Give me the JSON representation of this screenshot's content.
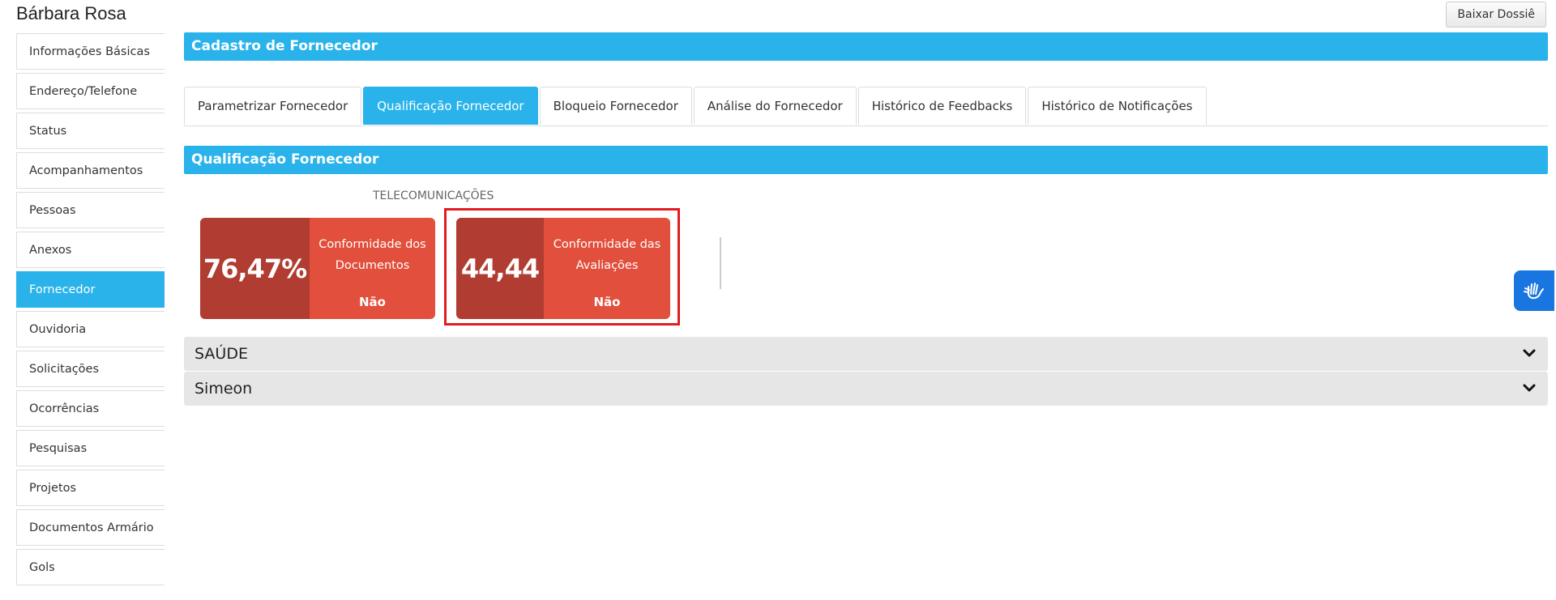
{
  "header": {
    "person_name": "Bárbara Rosa",
    "download_label": "Baixar Dossiê"
  },
  "sidebar": {
    "items": [
      {
        "label": "Informações Básicas",
        "active": false
      },
      {
        "label": "Endereço/Telefone",
        "active": false
      },
      {
        "label": "Status",
        "active": false
      },
      {
        "label": "Acompanhamentos",
        "active": false
      },
      {
        "label": "Pessoas",
        "active": false
      },
      {
        "label": "Anexos",
        "active": false
      },
      {
        "label": "Fornecedor",
        "active": true
      },
      {
        "label": "Ouvidoria",
        "active": false
      },
      {
        "label": "Solicitações",
        "active": false
      },
      {
        "label": "Ocorrências",
        "active": false
      },
      {
        "label": "Pesquisas",
        "active": false
      },
      {
        "label": "Projetos",
        "active": false
      },
      {
        "label": "Documentos Armário",
        "active": false
      },
      {
        "label": "Gols",
        "active": false
      }
    ]
  },
  "main": {
    "section_title": "Cadastro de Fornecedor",
    "tabs": [
      {
        "label": "Parametrizar Fornecedor",
        "active": false
      },
      {
        "label": "Qualificação Fornecedor",
        "active": true
      },
      {
        "label": "Bloqueio Fornecedor",
        "active": false
      },
      {
        "label": "Análise do Fornecedor",
        "active": false
      },
      {
        "label": "Histórico de Feedbacks",
        "active": false
      },
      {
        "label": "Histórico de Notificações",
        "active": false
      }
    ],
    "qualification_title": "Qualificação Fornecedor",
    "category": "TELECOMUNICAÇÕES",
    "cards": [
      {
        "value": "76,47%",
        "label": "Conformidade dos Documentos",
        "status": "Não"
      },
      {
        "value": "44,44",
        "label": "Conformidade das Avaliações",
        "status": "Não"
      }
    ],
    "accordions": [
      {
        "label": "SAÚDE"
      },
      {
        "label": "Simeon"
      }
    ]
  },
  "colors": {
    "accent": "#29b3ea",
    "card_dark": "#b13c31",
    "card_light": "#e24f3c",
    "highlight": "#e31b23"
  },
  "icons": {
    "accordion": "chevron-down-icon",
    "accessibility": "sign-language-icon"
  }
}
